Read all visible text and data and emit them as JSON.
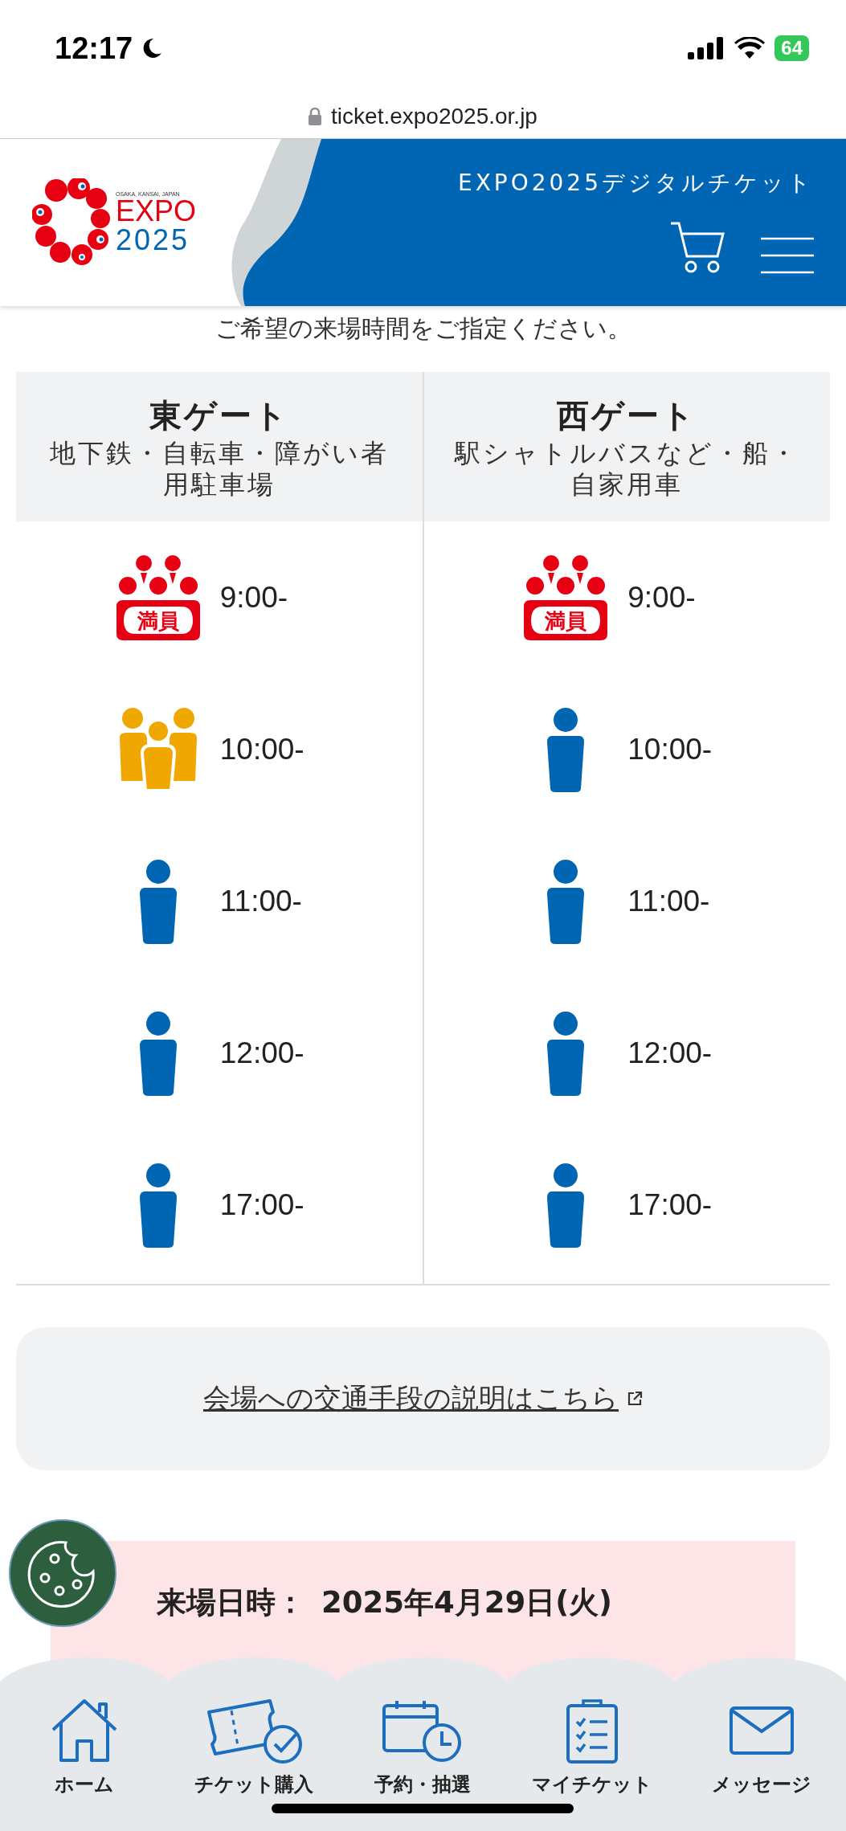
{
  "status_bar": {
    "time": "12:17",
    "battery": "64"
  },
  "address_bar": {
    "url": "ticket.expo2025.or.jp"
  },
  "header": {
    "logo_caption": "OSAKA, KANSAI, JAPAN",
    "logo_word": "EXPO",
    "logo_year": "2025",
    "title": "EXPO2025デジタルチケット"
  },
  "instruction": "ご希望の来場時間をご指定ください。",
  "gates": [
    {
      "name": "東ゲート",
      "access": "地下鉄・自転車・障がい者用駐車場",
      "slots": [
        {
          "time": "9:00-",
          "kind": "full",
          "badge": "満員"
        },
        {
          "time": "10:00-",
          "kind": "crowded"
        },
        {
          "time": "11:00-",
          "kind": "available"
        },
        {
          "time": "12:00-",
          "kind": "available"
        },
        {
          "time": "17:00-",
          "kind": "available"
        }
      ]
    },
    {
      "name": "西ゲート",
      "access": "駅シャトルバスなど・船・自家用車",
      "slots": [
        {
          "time": "9:00-",
          "kind": "full",
          "badge": "満員"
        },
        {
          "time": "10:00-",
          "kind": "available"
        },
        {
          "time": "11:00-",
          "kind": "available"
        },
        {
          "time": "12:00-",
          "kind": "available"
        },
        {
          "time": "17:00-",
          "kind": "available"
        }
      ]
    }
  ],
  "transport_link": "会場への交通手段の説明はこちら",
  "visit": {
    "label": "来場日時：",
    "date": "2025年4月29日(火)"
  },
  "bottom_nav": [
    {
      "kind": "home",
      "label": "ホーム"
    },
    {
      "kind": "ticket",
      "label": "チケット購入"
    },
    {
      "kind": "calendar",
      "label": "予約・抽選"
    },
    {
      "kind": "clipboard",
      "label": "マイチケット"
    },
    {
      "kind": "mail",
      "label": "メッセージ"
    }
  ]
}
